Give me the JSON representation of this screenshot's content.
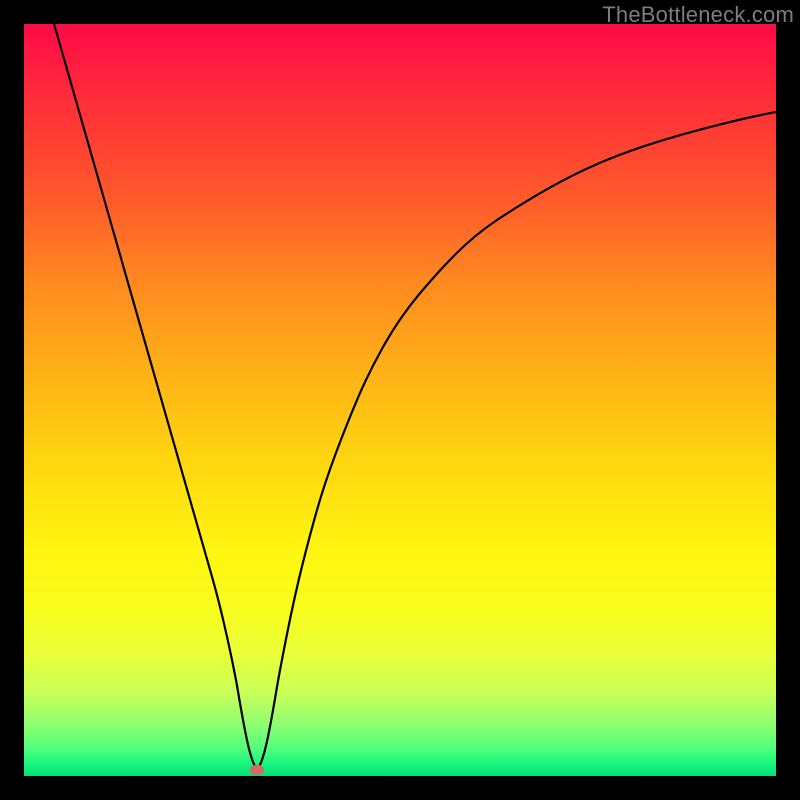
{
  "watermark": "TheBottleneck.com",
  "chart_data": {
    "type": "line",
    "title": "",
    "xlabel": "",
    "ylabel": "",
    "xlim": [
      0,
      100
    ],
    "ylim": [
      0,
      100
    ],
    "series": [
      {
        "name": "bottleneck-curve",
        "x": [
          4,
          6,
          8,
          10,
          12,
          14,
          16,
          18,
          20,
          22,
          24,
          26,
          28,
          29,
          30,
          31,
          32,
          33,
          34,
          36,
          38,
          40,
          43,
          46,
          50,
          55,
          60,
          66,
          73,
          80,
          88,
          96,
          100
        ],
        "y": [
          100,
          93,
          86,
          79,
          72,
          65,
          58,
          51,
          44,
          37,
          30,
          23,
          14,
          8,
          3,
          0.5,
          3,
          8,
          14,
          24,
          32,
          39,
          47,
          54,
          61,
          67,
          72,
          76,
          80,
          83,
          85.5,
          87.5,
          88.3
        ]
      }
    ],
    "marker": {
      "x": 31,
      "y": 0.8
    },
    "gradient_colors": {
      "top": "#ff0a46",
      "mid": "#ffd610",
      "bottom": "#08dd74"
    }
  }
}
